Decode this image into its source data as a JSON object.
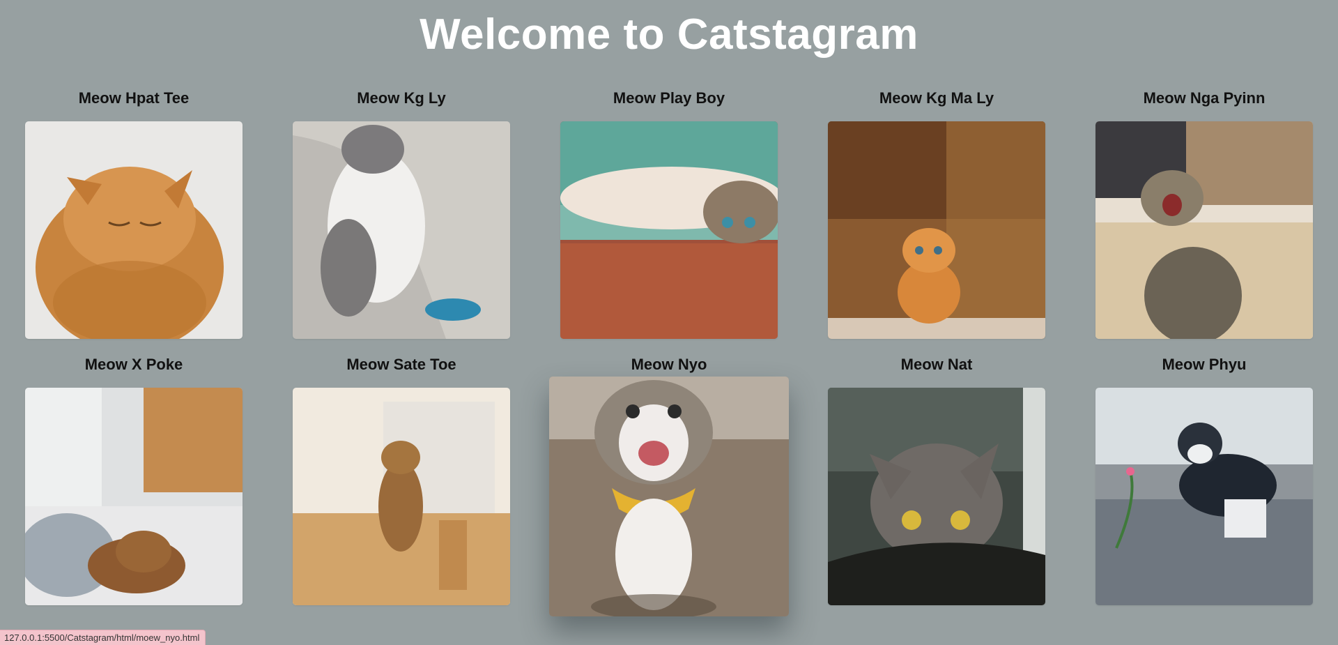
{
  "page": {
    "title": "Welcome to Catstagram"
  },
  "cards": [
    {
      "name": "Meow Hpat Tee"
    },
    {
      "name": "Meow Kg Ly"
    },
    {
      "name": "Meow Play Boy"
    },
    {
      "name": "Meow Kg Ma Ly"
    },
    {
      "name": "Meow Nga Pyinn"
    },
    {
      "name": "Meow X Poke"
    },
    {
      "name": "Meow Sate Toe"
    },
    {
      "name": "Meow Nyo"
    },
    {
      "name": "Meow Nat"
    },
    {
      "name": "Meow Phyu"
    }
  ],
  "status_bar": {
    "url": "127.0.0.1:5500/Catstagram/html/moew_nyo.html"
  },
  "colors": {
    "background": "#97a0a1",
    "title": "#ffffff",
    "card_title": "#111111"
  }
}
